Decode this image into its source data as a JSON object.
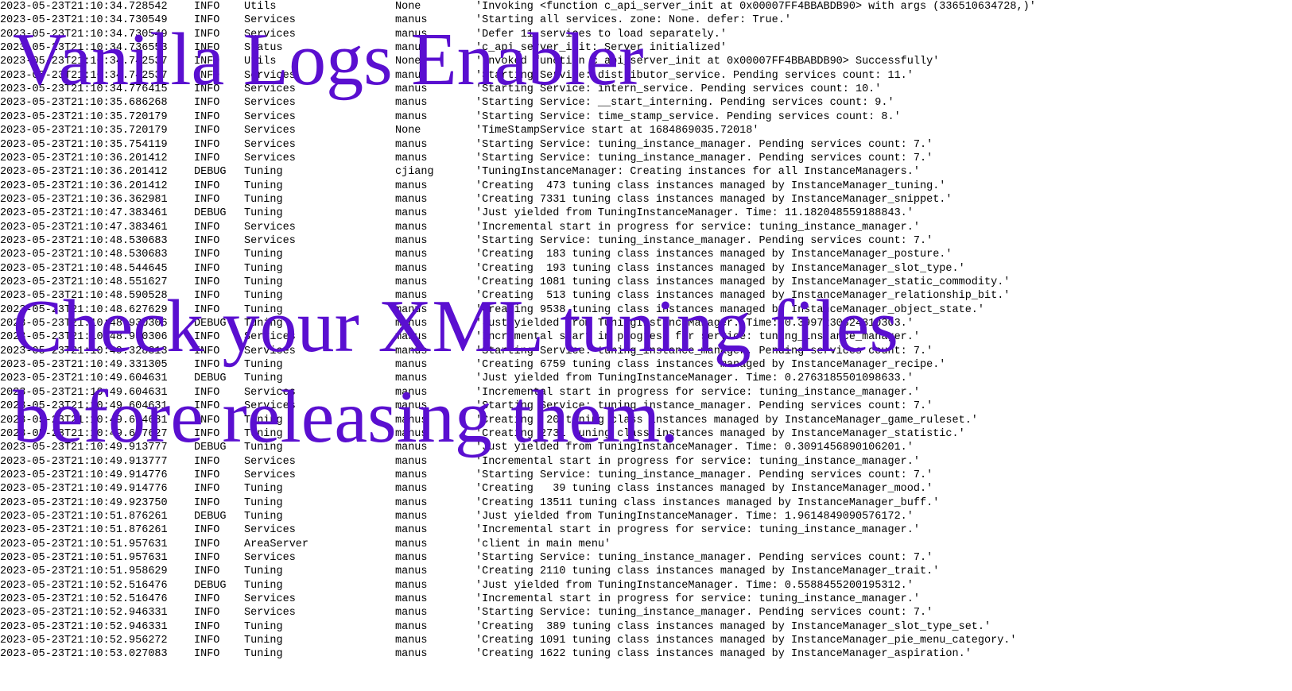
{
  "overlay": {
    "line1": "Vanilla Logs Enabler",
    "line2": "Check your XML tuning files",
    "line3": "before releasing them.",
    "text_color": "#5a0fd0"
  },
  "log_rows": [
    [
      "2023-05-23T21:10:34.728542",
      "INFO",
      "Utils",
      "None",
      "'Invoking <function c_api_server_init at 0x00007FF4BBABDB90> with args (336510634728,)'"
    ],
    [
      "2023-05-23T21:10:34.730549",
      "INFO",
      "Services",
      "manus",
      "'Starting all services. zone: None. defer: True.'"
    ],
    [
      "2023-05-23T21:10:34.730549",
      "INFO",
      "Services",
      "manus",
      "'Defer 11 services to load separately.'"
    ],
    [
      "2023-05-23T21:10:34.736553",
      "INFO",
      "Status",
      "manus",
      "'c_api_server_init: Server initialized'"
    ],
    [
      "2023-05-23T21:10:34.742537",
      "INFO",
      "Utils",
      "None",
      "'Invoked function c_api_server_init at 0x00007FF4BBABDB90> Successfully'"
    ],
    [
      "2023-05-23T21:10:34.742537",
      "INFO",
      "Services",
      "manus",
      "'Starting Service: distributor_service. Pending services count: 11.'"
    ],
    [
      "2023-05-23T21:10:34.776415",
      "INFO",
      "Services",
      "manus",
      "'Starting Service: intern_service. Pending services count: 10.'"
    ],
    [
      "2023-05-23T21:10:35.686268",
      "INFO",
      "Services",
      "manus",
      "'Starting Service: __start_interning. Pending services count: 9.'"
    ],
    [
      "2023-05-23T21:10:35.720179",
      "INFO",
      "Services",
      "manus",
      "'Starting Service: time_stamp_service. Pending services count: 8.'"
    ],
    [
      "2023-05-23T21:10:35.720179",
      "INFO",
      "Services",
      "None",
      "'TimeStampService start at 1684869035.72018'"
    ],
    [
      "2023-05-23T21:10:35.754119",
      "INFO",
      "Services",
      "manus",
      "'Starting Service: tuning_instance_manager. Pending services count: 7.'"
    ],
    [
      "2023-05-23T21:10:36.201412",
      "INFO",
      "Services",
      "manus",
      "'Starting Service: tuning_instance_manager. Pending services count: 7.'"
    ],
    [
      "2023-05-23T21:10:36.201412",
      "DEBUG",
      "Tuning",
      "cjiang",
      "'TuningInstanceManager: Creating instances for all InstanceManagers.'"
    ],
    [
      "2023-05-23T21:10:36.201412",
      "INFO",
      "Tuning",
      "manus",
      "'Creating  473 tuning class instances managed by InstanceManager_tuning.'"
    ],
    [
      "2023-05-23T21:10:36.362981",
      "INFO",
      "Tuning",
      "manus",
      "'Creating 7331 tuning class instances managed by InstanceManager_snippet.'"
    ],
    [
      "2023-05-23T21:10:47.383461",
      "DEBUG",
      "Tuning",
      "manus",
      "'Just yielded from TuningInstanceManager. Time: 11.182048559188843.'"
    ],
    [
      "2023-05-23T21:10:47.383461",
      "INFO",
      "Services",
      "manus",
      "'Incremental start in progress for service: tuning_instance_manager.'"
    ],
    [
      "2023-05-23T21:10:48.530683",
      "INFO",
      "Services",
      "manus",
      "'Starting Service: tuning_instance_manager. Pending services count: 7.'"
    ],
    [
      "2023-05-23T21:10:48.530683",
      "INFO",
      "Tuning",
      "manus",
      "'Creating  183 tuning class instances managed by InstanceManager_posture.'"
    ],
    [
      "2023-05-23T21:10:48.544645",
      "INFO",
      "Tuning",
      "manus",
      "'Creating  193 tuning class instances managed by InstanceManager_slot_type.'"
    ],
    [
      "2023-05-23T21:10:48.551627",
      "INFO",
      "Tuning",
      "manus",
      "'Creating 1081 tuning class instances managed by InstanceManager_static_commodity.'"
    ],
    [
      "2023-05-23T21:10:48.590528",
      "INFO",
      "Tuning",
      "manus",
      "'Creating  513 tuning class instances managed by InstanceManager_relationship_bit.'"
    ],
    [
      "2023-05-23T21:10:48.627629",
      "INFO",
      "Tuning",
      "manus",
      "'Creating 9538 tuning class instances managed by InstanceManager_object_state.'"
    ],
    [
      "2023-05-23T21:10:48.930306",
      "DEBUG",
      "Tuning",
      "manus",
      "'Just yielded from TuningInstanceManager. Time: 0.3997230324310303.'"
    ],
    [
      "2023-05-23T21:10:48.930306",
      "INFO",
      "Services",
      "manus",
      "'Incremental start in progress for service: tuning_instance_manager.'"
    ],
    [
      "2023-05-23T21:10:49.328313",
      "INFO",
      "Services",
      "manus",
      "'Starting Service: tuning_instance_manager. Pending services count: 7.'"
    ],
    [
      "2023-05-23T21:10:49.331305",
      "INFO",
      "Tuning",
      "manus",
      "'Creating 6759 tuning class instances managed by InstanceManager_recipe.'"
    ],
    [
      "2023-05-23T21:10:49.604631",
      "DEBUG",
      "Tuning",
      "manus",
      "'Just yielded from TuningInstanceManager. Time: 0.2763185501098633.'"
    ],
    [
      "2023-05-23T21:10:49.604631",
      "INFO",
      "Services",
      "manus",
      "'Incremental start in progress for service: tuning_instance_manager.'"
    ],
    [
      "2023-05-23T21:10:49.604631",
      "INFO",
      "Services",
      "manus",
      "'Starting Service: tuning_instance_manager. Pending services count: 7.'"
    ],
    [
      "2023-05-23T21:10:49.604631",
      "INFO",
      "Tuning",
      "manus",
      "'Creating  20 tuning class instances managed by InstanceManager_game_ruleset.'"
    ],
    [
      "2023-05-23T21:10:49.607627",
      "INFO",
      "Tuning",
      "manus",
      "'Creating 2731 tuning class instances managed by InstanceManager_statistic.'"
    ],
    [
      "2023-05-23T21:10:49.913777",
      "DEBUG",
      "Tuning",
      "manus",
      "'Just yielded from TuningInstanceManager. Time: 0.3091456890106201.'"
    ],
    [
      "2023-05-23T21:10:49.913777",
      "INFO",
      "Services",
      "manus",
      "'Incremental start in progress for service: tuning_instance_manager.'"
    ],
    [
      "2023-05-23T21:10:49.914776",
      "INFO",
      "Services",
      "manus",
      "'Starting Service: tuning_instance_manager. Pending services count: 7.'"
    ],
    [
      "2023-05-23T21:10:49.914776",
      "INFO",
      "Tuning",
      "manus",
      "'Creating   39 tuning class instances managed by InstanceManager_mood.'"
    ],
    [
      "2023-05-23T21:10:49.923750",
      "INFO",
      "Tuning",
      "manus",
      "'Creating 13511 tuning class instances managed by InstanceManager_buff.'"
    ],
    [
      "2023-05-23T21:10:51.876261",
      "DEBUG",
      "Tuning",
      "manus",
      "'Just yielded from TuningInstanceManager. Time: 1.9614849090576172.'"
    ],
    [
      "2023-05-23T21:10:51.876261",
      "INFO",
      "Services",
      "manus",
      "'Incremental start in progress for service: tuning_instance_manager.'"
    ],
    [
      "2023-05-23T21:10:51.957631",
      "INFO",
      "AreaServer",
      "manus",
      "'client in main menu'"
    ],
    [
      "2023-05-23T21:10:51.957631",
      "INFO",
      "Services",
      "manus",
      "'Starting Service: tuning_instance_manager. Pending services count: 7.'"
    ],
    [
      "2023-05-23T21:10:51.958629",
      "INFO",
      "Tuning",
      "manus",
      "'Creating 2110 tuning class instances managed by InstanceManager_trait.'"
    ],
    [
      "2023-05-23T21:10:52.516476",
      "DEBUG",
      "Tuning",
      "manus",
      "'Just yielded from TuningInstanceManager. Time: 0.5588455200195312.'"
    ],
    [
      "2023-05-23T21:10:52.516476",
      "INFO",
      "Services",
      "manus",
      "'Incremental start in progress for service: tuning_instance_manager.'"
    ],
    [
      "2023-05-23T21:10:52.946331",
      "INFO",
      "Services",
      "manus",
      "'Starting Service: tuning_instance_manager. Pending services count: 7.'"
    ],
    [
      "2023-05-23T21:10:52.946331",
      "INFO",
      "Tuning",
      "manus",
      "'Creating  389 tuning class instances managed by InstanceManager_slot_type_set.'"
    ],
    [
      "2023-05-23T21:10:52.956272",
      "INFO",
      "Tuning",
      "manus",
      "'Creating 1091 tuning class instances managed by InstanceManager_pie_menu_category.'"
    ],
    [
      "2023-05-23T21:10:53.027083",
      "INFO",
      "Tuning",
      "manus",
      "'Creating 1622 tuning class instances managed by InstanceManager_aspiration.'"
    ]
  ]
}
